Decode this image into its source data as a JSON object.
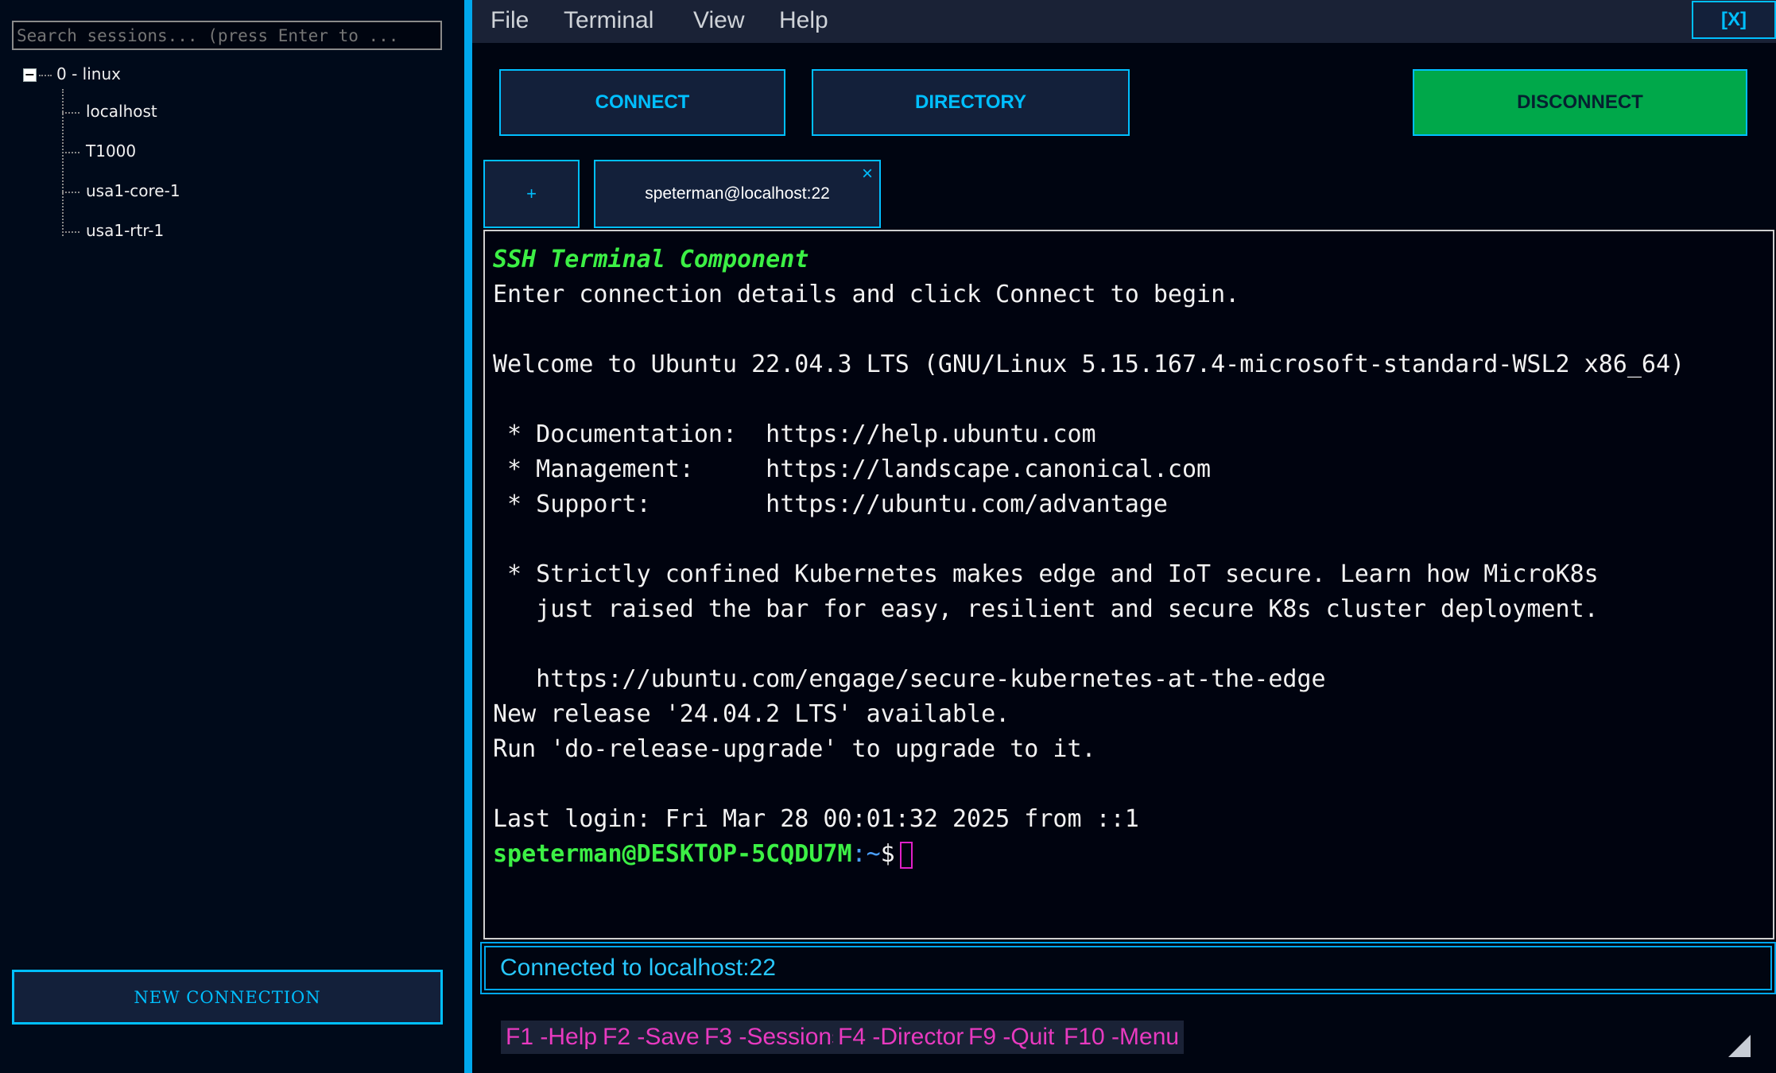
{
  "sidebar": {
    "search": {
      "placeholder": "Search sessions... (press Enter to ..."
    },
    "tree": {
      "root": {
        "expander": "−",
        "label": "0 - linux"
      },
      "children": [
        "localhost",
        "T1000",
        "usa1-core-1",
        "usa1-rtr-1"
      ]
    },
    "new_connection_label": "NEW CONNECTION"
  },
  "menubar": {
    "items": [
      "File",
      "Terminal",
      "View",
      "Help"
    ],
    "close_label": "[X]"
  },
  "toolbar": {
    "connect_label": "CONNECT",
    "directory_label": "DIRECTORY",
    "disconnect_label": "DISCONNECT"
  },
  "tabs": {
    "add_label": "+",
    "session_label": "speterman@localhost:22",
    "close_glyph": "×"
  },
  "terminal": {
    "title": "SSH Terminal Component",
    "lines": [
      "Enter connection details and click Connect to begin.",
      "",
      "Welcome to Ubuntu 22.04.3 LTS (GNU/Linux 5.15.167.4-microsoft-standard-WSL2 x86_64)",
      "",
      " * Documentation:  https://help.ubuntu.com",
      " * Management:     https://landscape.canonical.com",
      " * Support:        https://ubuntu.com/advantage",
      "",
      " * Strictly confined Kubernetes makes edge and IoT secure. Learn how MicroK8s",
      "   just raised the bar for easy, resilient and secure K8s cluster deployment.",
      "",
      "   https://ubuntu.com/engage/secure-kubernetes-at-the-edge",
      "New release '24.04.2 LTS' available.",
      "Run 'do-release-upgrade' to upgrade to it.",
      "",
      "Last login: Fri Mar 28 00:01:32 2025 from ::1"
    ],
    "prompt": {
      "user_host": "speterman@DESKTOP-5CQDU7M",
      "sep": ":",
      "path": "~",
      "symbol": "$"
    }
  },
  "status": {
    "text": "Connected to localhost:22"
  },
  "fkeys": [
    {
      "key": "F1",
      "label": "Help"
    },
    {
      "key": "F2",
      "label": "Save"
    },
    {
      "key": "F3",
      "label": "Sessions"
    },
    {
      "key": "F4",
      "label": "Directory"
    },
    {
      "key": "F9",
      "label": "Quit"
    },
    {
      "key": "F10",
      "label": "Menu"
    }
  ],
  "colors": {
    "accent": "#00bfff",
    "disconnect": "#00a84a",
    "prompt_green": "#3cf045",
    "fkey_pink": "#e83ac0",
    "status_text": "#28c8ff"
  }
}
